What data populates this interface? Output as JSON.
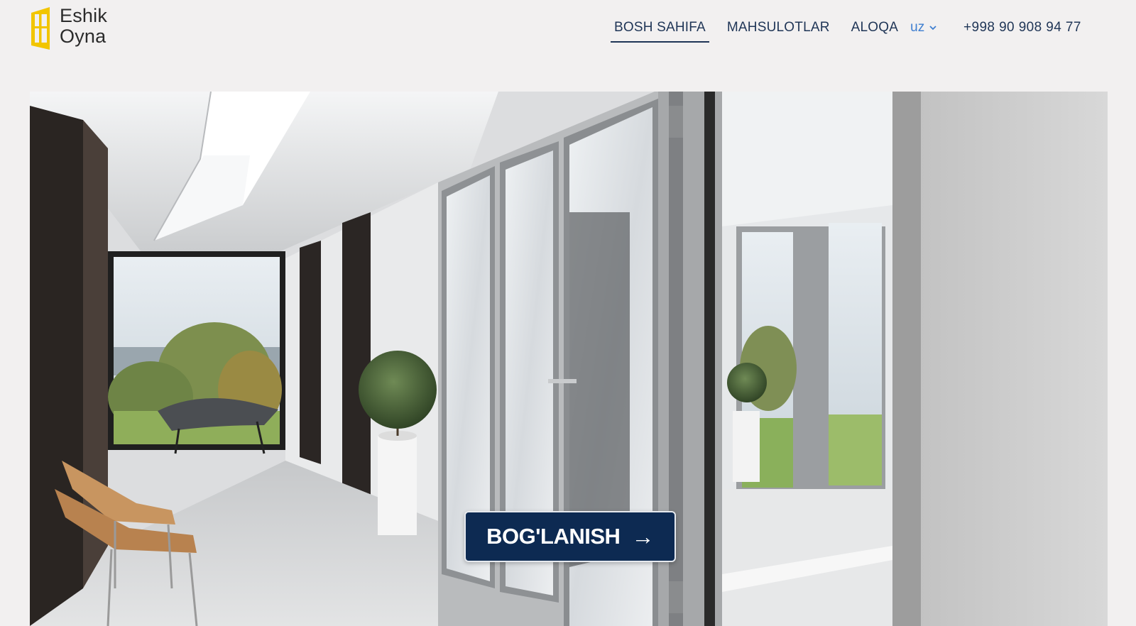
{
  "brand": {
    "line1": "Eshik",
    "line2": "Oyna",
    "accent_color": "#f2c500",
    "icon": "door-window-logo-icon"
  },
  "nav": {
    "items": [
      {
        "label": "BOSH SAHIFA",
        "active": true
      },
      {
        "label": "MAHSULOTLAR",
        "active": false
      },
      {
        "label": "ALOQA",
        "active": false
      }
    ],
    "language": "uz",
    "language_icon": "chevron-down-icon",
    "phone": "+998 90 908 94 77"
  },
  "hero": {
    "image": "interior-glass-doors-photo",
    "cta_label": "BOG'LANISH",
    "cta_arrow": "→",
    "cta_color": "#0d2a52"
  },
  "colors": {
    "page_bg": "#f2f0f0",
    "nav_text": "#1f3556",
    "lang_text": "#3f7fd0"
  }
}
